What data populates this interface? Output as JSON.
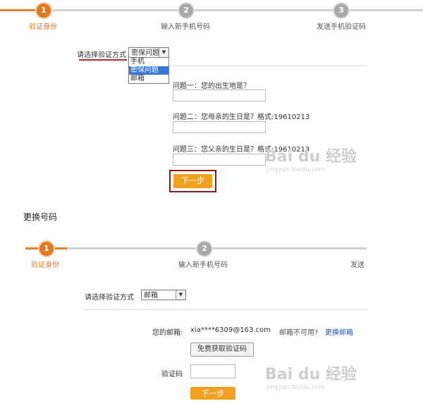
{
  "panel1": {
    "steps": [
      {
        "num": "1",
        "label": "验证身份"
      },
      {
        "num": "2",
        "label": "输入新手机号码"
      },
      {
        "num": "3",
        "label": "发送手机验证码"
      }
    ],
    "method_label": "请选择验证方式",
    "select_value": "密保问题",
    "dropdown_options": [
      "手机",
      "密保问题",
      "邮箱"
    ],
    "questions": [
      "问题一：您的出生地是？",
      "问题二：您母亲的生日是？格式:19610213",
      "问题三：您父亲的生日是？格式:19610213"
    ],
    "next_label": "下一步"
  },
  "section_title": "更换号码",
  "panel2": {
    "steps": [
      {
        "num": "1",
        "label": "验证身份"
      },
      {
        "num": "2",
        "label": "输入新手机号码"
      },
      {
        "num": "",
        "label": "发送"
      }
    ],
    "method_label": "请选择验证方式",
    "select_value": "邮箱",
    "email_label": "您的邮箱:",
    "email_value": "xia****6309@163.com",
    "email_unavailable": "邮箱不可用?",
    "change_email_link": "更换邮箱",
    "get_code_label": "免费获取验证码",
    "code_label": "验证码",
    "next_label": "下一步"
  },
  "watermark": {
    "logo": "Bai du 经验",
    "url": "jingyan.baidu.com"
  },
  "colors": {
    "accent": "#e07a22",
    "button": "#f2a01e",
    "link": "#1a56b8",
    "underline": "#c0282d",
    "highlight_border": "#8b1a1a"
  }
}
